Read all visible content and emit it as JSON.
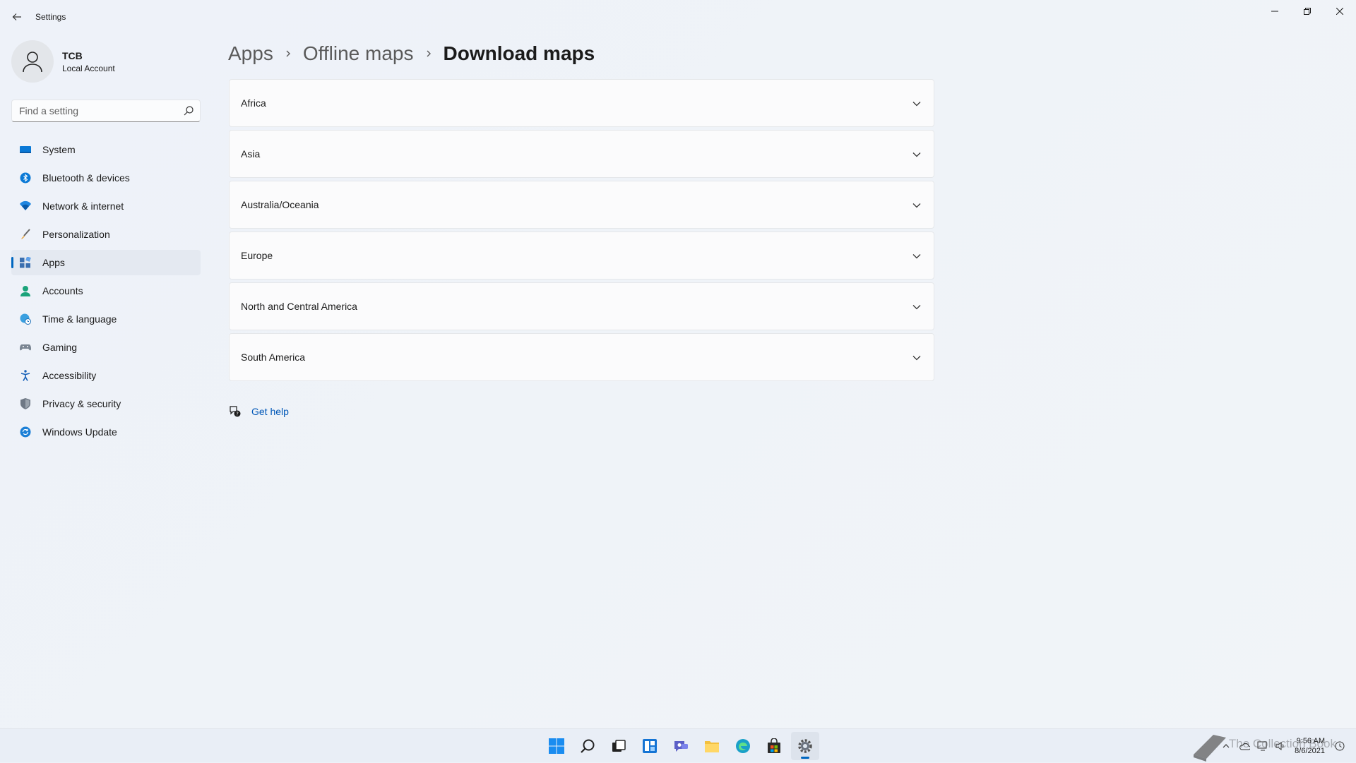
{
  "window": {
    "title": "Settings",
    "controls": [
      "minimize",
      "restore",
      "close"
    ]
  },
  "profile": {
    "name": "TCB",
    "account_type": "Local Account"
  },
  "search": {
    "placeholder": "Find a setting"
  },
  "sidebar": {
    "items": [
      {
        "label": "System",
        "icon": "system-icon",
        "active": false
      },
      {
        "label": "Bluetooth & devices",
        "icon": "bluetooth-icon",
        "active": false
      },
      {
        "label": "Network & internet",
        "icon": "network-icon",
        "active": false
      },
      {
        "label": "Personalization",
        "icon": "brush-icon",
        "active": false
      },
      {
        "label": "Apps",
        "icon": "apps-icon",
        "active": true
      },
      {
        "label": "Accounts",
        "icon": "person-icon",
        "active": false
      },
      {
        "label": "Time & language",
        "icon": "globe-clock-icon",
        "active": false
      },
      {
        "label": "Gaming",
        "icon": "gamepad-icon",
        "active": false
      },
      {
        "label": "Accessibility",
        "icon": "accessibility-icon",
        "active": false
      },
      {
        "label": "Privacy & security",
        "icon": "shield-icon",
        "active": false
      },
      {
        "label": "Windows Update",
        "icon": "update-icon",
        "active": false
      }
    ]
  },
  "breadcrumb": {
    "items": [
      "Apps",
      "Offline maps",
      "Download maps"
    ]
  },
  "regions": [
    {
      "label": "Africa"
    },
    {
      "label": "Asia"
    },
    {
      "label": "Australia/Oceania"
    },
    {
      "label": "Europe"
    },
    {
      "label": "North and Central America"
    },
    {
      "label": "South America"
    }
  ],
  "help": {
    "label": "Get help"
  },
  "taskbar": {
    "apps": [
      "start-icon",
      "search-icon",
      "task-view-icon",
      "widgets-icon",
      "chat-icon",
      "file-explorer-icon",
      "edge-icon",
      "store-icon",
      "settings-icon"
    ],
    "active_app": "settings-icon",
    "time": "9:56 AM",
    "date": "8/6/2021",
    "watermark": "The Collection Book"
  },
  "colors": {
    "accent": "#0067c0",
    "link": "#0057b7",
    "background": "#eef2f8",
    "card": "#fbfbfc"
  }
}
